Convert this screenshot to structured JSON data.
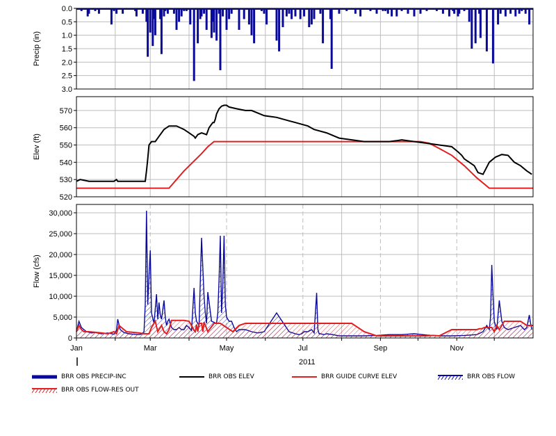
{
  "chart_data": [
    {
      "id": "precip",
      "type": "bar",
      "ylabel": "Precip (in)",
      "ylim": [
        0,
        3.0
      ],
      "y_inverted": true,
      "yticks": [
        "0.0",
        "0.5",
        "1.0",
        "1.5",
        "2.0",
        "2.5",
        "3.0"
      ],
      "ytick_values": [
        0,
        0.5,
        1.0,
        1.5,
        2.0,
        2.5,
        3.0
      ],
      "grid": true,
      "series": [
        {
          "name": "BRR OBS PRECIP-INC",
          "color": "#0a0a9a",
          "day_of_year": [
            4,
            9,
            10,
            15,
            16,
            18,
            28,
            30,
            32,
            37,
            47,
            48,
            53,
            56,
            57,
            59,
            61,
            62,
            63,
            67,
            68,
            70,
            71,
            73,
            78,
            80,
            82,
            84,
            86,
            88,
            91,
            94,
            97,
            99,
            100,
            102,
            104,
            108,
            109,
            110,
            112,
            114,
            115,
            117,
            120,
            122,
            124,
            130,
            134,
            138,
            140,
            142,
            148,
            150,
            152,
            160,
            162,
            165,
            168,
            170,
            172,
            175,
            179,
            182,
            186,
            188,
            190,
            195,
            197,
            203,
            204,
            210,
            216,
            223,
            227,
            235,
            240,
            245,
            247,
            249,
            252,
            256,
            260,
            265,
            270,
            275,
            280,
            288,
            293,
            298,
            301,
            302,
            305,
            306,
            310,
            314,
            316,
            319,
            322,
            323,
            328,
            333,
            337,
            339,
            343,
            347,
            351,
            354,
            356,
            359,
            362
          ],
          "values": [
            0.1,
            0.3,
            0.2,
            0.1,
            0.05,
            0.2,
            0.6,
            0.1,
            0.2,
            0.2,
            0.1,
            0.3,
            0.2,
            0.5,
            1.8,
            0.9,
            1.4,
            0.4,
            1.0,
            0.4,
            1.7,
            0.3,
            0.1,
            0.2,
            0.2,
            0.8,
            0.5,
            0.3,
            0.1,
            0.1,
            0.6,
            2.7,
            1.3,
            0.4,
            0.3,
            0.2,
            0.8,
            1.1,
            0.5,
            0.9,
            1.2,
            0.2,
            2.3,
            0.3,
            0.8,
            0.4,
            0.2,
            0.8,
            0.4,
            0.6,
            1.0,
            1.3,
            0.1,
            0.2,
            0.6,
            1.2,
            1.6,
            0.7,
            0.3,
            0.2,
            0.4,
            0.3,
            0.4,
            0.3,
            0.7,
            0.6,
            0.4,
            0.2,
            1.3,
            0.4,
            2.25,
            0.2,
            0.1,
            0.2,
            0.3,
            0.1,
            0.2,
            0.1,
            0.1,
            0.2,
            0.3,
            0.3,
            0.1,
            0.2,
            0.3,
            0.2,
            0.1,
            0.1,
            0.2,
            0.3,
            0.1,
            0.2,
            0.3,
            0.2,
            0.1,
            0.5,
            1.5,
            1.3,
            0.2,
            1.1,
            1.6,
            2.05,
            0.6,
            0.2,
            0.3,
            0.2,
            0.3,
            0.2,
            0.1,
            0.2,
            0.6
          ]
        }
      ]
    },
    {
      "id": "elev",
      "type": "line",
      "ylabel": "Elev (ft)",
      "ylim": [
        520,
        578
      ],
      "yticks": [
        "520",
        "530",
        "540",
        "550",
        "560",
        "570"
      ],
      "ytick_values": [
        520,
        530,
        540,
        550,
        560,
        570
      ],
      "grid": true,
      "series": [
        {
          "name": "BRR OBS ELEV",
          "color": "#000000",
          "day_of_year": [
            0,
            3,
            10,
            20,
            30,
            32,
            33,
            40,
            50,
            54,
            55,
            56,
            57,
            58,
            60,
            63,
            66,
            70,
            74,
            80,
            86,
            90,
            94,
            95,
            97,
            100,
            104,
            106,
            108,
            109,
            110,
            111,
            112,
            114,
            116,
            118,
            120,
            122,
            128,
            135,
            140,
            150,
            160,
            170,
            175,
            180,
            185,
            190,
            200,
            210,
            220,
            230,
            240,
            250,
            256,
            260,
            270,
            280,
            290,
            300,
            305,
            308,
            310,
            312,
            314,
            316,
            318,
            321,
            325,
            330,
            335,
            340,
            345,
            350,
            355,
            360,
            362,
            364
          ],
          "values": [
            529,
            530,
            529,
            529,
            529,
            530,
            529,
            529,
            529,
            529,
            529,
            535,
            542,
            550,
            552,
            552,
            555,
            559,
            561,
            561,
            559,
            557,
            555,
            554,
            556,
            557,
            556,
            560,
            562,
            563,
            563,
            565,
            568,
            571,
            572.5,
            573,
            573,
            572,
            571,
            570,
            570,
            567,
            566,
            564,
            563,
            562,
            561,
            559,
            557,
            554,
            553,
            552,
            552,
            552,
            552.5,
            553,
            552,
            551,
            550,
            549,
            546,
            544,
            542,
            541,
            540,
            539,
            538,
            534,
            533,
            540,
            543,
            544.5,
            544,
            540,
            538,
            535,
            534,
            533
          ]
        },
        {
          "name": "BRR GUIDE CURVE ELEV",
          "color": "#e02020",
          "day_of_year": [
            0,
            74,
            86,
            100,
            105,
            110,
            152,
            190,
            275,
            282,
            290,
            300,
            310,
            320,
            330,
            365
          ],
          "values": [
            525,
            525,
            535,
            545,
            549,
            552,
            552,
            552,
            552,
            551,
            548,
            544,
            538,
            531,
            525,
            525
          ]
        }
      ]
    },
    {
      "id": "flow",
      "type": "area",
      "ylabel": "Flow (cfs)",
      "ylim": [
        0,
        32000
      ],
      "yticks": [
        "0",
        "5,000",
        "10,000",
        "15,000",
        "20,000",
        "25,000",
        "30,000"
      ],
      "ytick_values": [
        0,
        5000,
        10000,
        15000,
        20000,
        25000,
        30000
      ],
      "xticks": [
        "Jan",
        "Mar",
        "May",
        "Jul",
        "Sep",
        "Nov"
      ],
      "xtick_days": [
        0,
        59,
        120,
        181,
        243,
        304
      ],
      "xlabel": "2011",
      "xlim_days": [
        0,
        365
      ],
      "grid": true,
      "series": [
        {
          "name": "BRR OBS FLOW",
          "color": "#0a0a9a",
          "day_of_year": [
            0,
            2,
            4,
            8,
            12,
            15,
            20,
            25,
            30,
            32,
            33,
            35,
            38,
            42,
            45,
            50,
            52,
            54,
            55,
            56,
            57,
            58,
            59,
            60,
            62,
            64,
            65,
            66,
            67,
            68,
            70,
            71,
            72,
            73,
            74,
            75,
            76,
            78,
            80,
            82,
            84,
            86,
            88,
            90,
            92,
            94,
            95,
            96,
            97,
            98,
            100,
            102,
            103,
            104,
            105,
            108,
            112,
            113,
            114,
            115,
            116,
            117,
            118,
            119,
            120,
            122,
            124,
            126,
            128,
            130,
            135,
            140,
            145,
            150,
            160,
            170,
            175,
            178,
            180,
            182,
            185,
            188,
            190,
            192,
            193,
            194,
            195,
            198,
            200,
            205,
            210,
            220,
            230,
            240,
            250,
            260,
            270,
            280,
            290,
            300,
            310,
            320,
            325,
            328,
            330,
            331,
            332,
            333,
            334,
            335,
            336,
            338,
            340,
            342,
            345,
            350,
            355,
            358,
            360,
            362,
            363,
            364
          ],
          "values": [
            1500,
            4000,
            2500,
            1500,
            1200,
            1300,
            1000,
            1200,
            900,
            1800,
            4500,
            2000,
            1300,
            1000,
            900,
            800,
            900,
            1500,
            8000,
            30500,
            8000,
            15000,
            21000,
            6000,
            3500,
            10500,
            4500,
            8500,
            5500,
            4500,
            9000,
            5000,
            3000,
            4000,
            4500,
            3500,
            2500,
            2000,
            2000,
            2500,
            2000,
            2000,
            3000,
            2500,
            1800,
            12000,
            6000,
            4000,
            3500,
            3000,
            24000,
            10000,
            6000,
            3500,
            11000,
            4000,
            3500,
            6000,
            14000,
            24500,
            6000,
            12500,
            24500,
            8000,
            5000,
            4000,
            4000,
            2500,
            1500,
            2000,
            2000,
            1500,
            1200,
            1500,
            6000,
            1500,
            1000,
            800,
            1000,
            1500,
            1500,
            2000,
            1200,
            10800,
            2000,
            1000,
            1000,
            800,
            1000,
            800,
            500,
            500,
            500,
            600,
            800,
            800,
            1000,
            700,
            500,
            500,
            600,
            800,
            1500,
            3000,
            2000,
            5000,
            17500,
            10000,
            4000,
            3000,
            2000,
            9000,
            4000,
            2500,
            2000,
            2500,
            3000,
            2000,
            2500,
            5500,
            3500,
            2000
          ]
        },
        {
          "name": "BRR OBS FLOW-RES OUT",
          "color": "#e02020",
          "day_of_year": [
            0,
            2,
            4,
            6,
            10,
            20,
            25,
            30,
            32,
            34,
            36,
            40,
            50,
            54,
            56,
            58,
            60,
            63,
            65,
            68,
            70,
            72,
            74,
            76,
            78,
            80,
            86,
            90,
            92,
            94,
            95,
            96,
            97,
            98,
            100,
            101,
            102,
            105,
            110,
            115,
            120,
            125,
            130,
            135,
            140,
            150,
            165,
            175,
            180,
            185,
            190,
            200,
            210,
            220,
            230,
            240,
            250,
            260,
            270,
            280,
            285,
            290,
            300,
            305,
            310,
            315,
            320,
            322,
            324,
            326,
            330,
            332,
            334,
            336,
            338,
            340,
            342,
            344,
            345,
            350,
            355,
            360,
            365
          ],
          "values": [
            1500,
            3000,
            2000,
            1500,
            1500,
            1200,
            1000,
            1500,
            1000,
            3000,
            2500,
            1500,
            1200,
            1000,
            1000,
            1000,
            2500,
            4000,
            1500,
            3000,
            1500,
            1000,
            2000,
            4200,
            4200,
            4200,
            4200,
            4000,
            3000,
            1800,
            1500,
            3200,
            1500,
            3500,
            3500,
            1500,
            3800,
            1500,
            3500,
            3500,
            2500,
            1500,
            3000,
            3500,
            3500,
            3500,
            3500,
            3500,
            3500,
            3500,
            3500,
            3500,
            3500,
            3500,
            1500,
            500,
            500,
            500,
            500,
            500,
            600,
            500,
            2000,
            2000,
            2000,
            2000,
            2000,
            2200,
            2200,
            2500,
            2500,
            2500,
            1500,
            3000,
            2000,
            3000,
            4000,
            4000,
            4000,
            4000,
            4000,
            3000,
            3000
          ]
        }
      ]
    }
  ],
  "legend": [
    {
      "key": "BRR OBS PRECIP-INC",
      "label": "BRR OBS PRECIP-INC",
      "symbol": "thick-bar",
      "color": "#0a0a9a"
    },
    {
      "key": "BRR OBS ELEV",
      "label": "BRR OBS ELEV",
      "symbol": "line",
      "color": "#000000"
    },
    {
      "key": "BRR GUIDE CURVE ELEV",
      "label": "BRR GUIDE CURVE ELEV",
      "symbol": "line",
      "color": "#e02020"
    },
    {
      "key": "BRR OBS FLOW",
      "label": "BRR OBS FLOW",
      "symbol": "hatch",
      "color": "#0a0a9a"
    },
    {
      "key": "BRR OBS FLOW-RES OUT",
      "label": "BRR OBS FLOW-RES OUT",
      "symbol": "hatch",
      "color": "#e02020"
    }
  ]
}
